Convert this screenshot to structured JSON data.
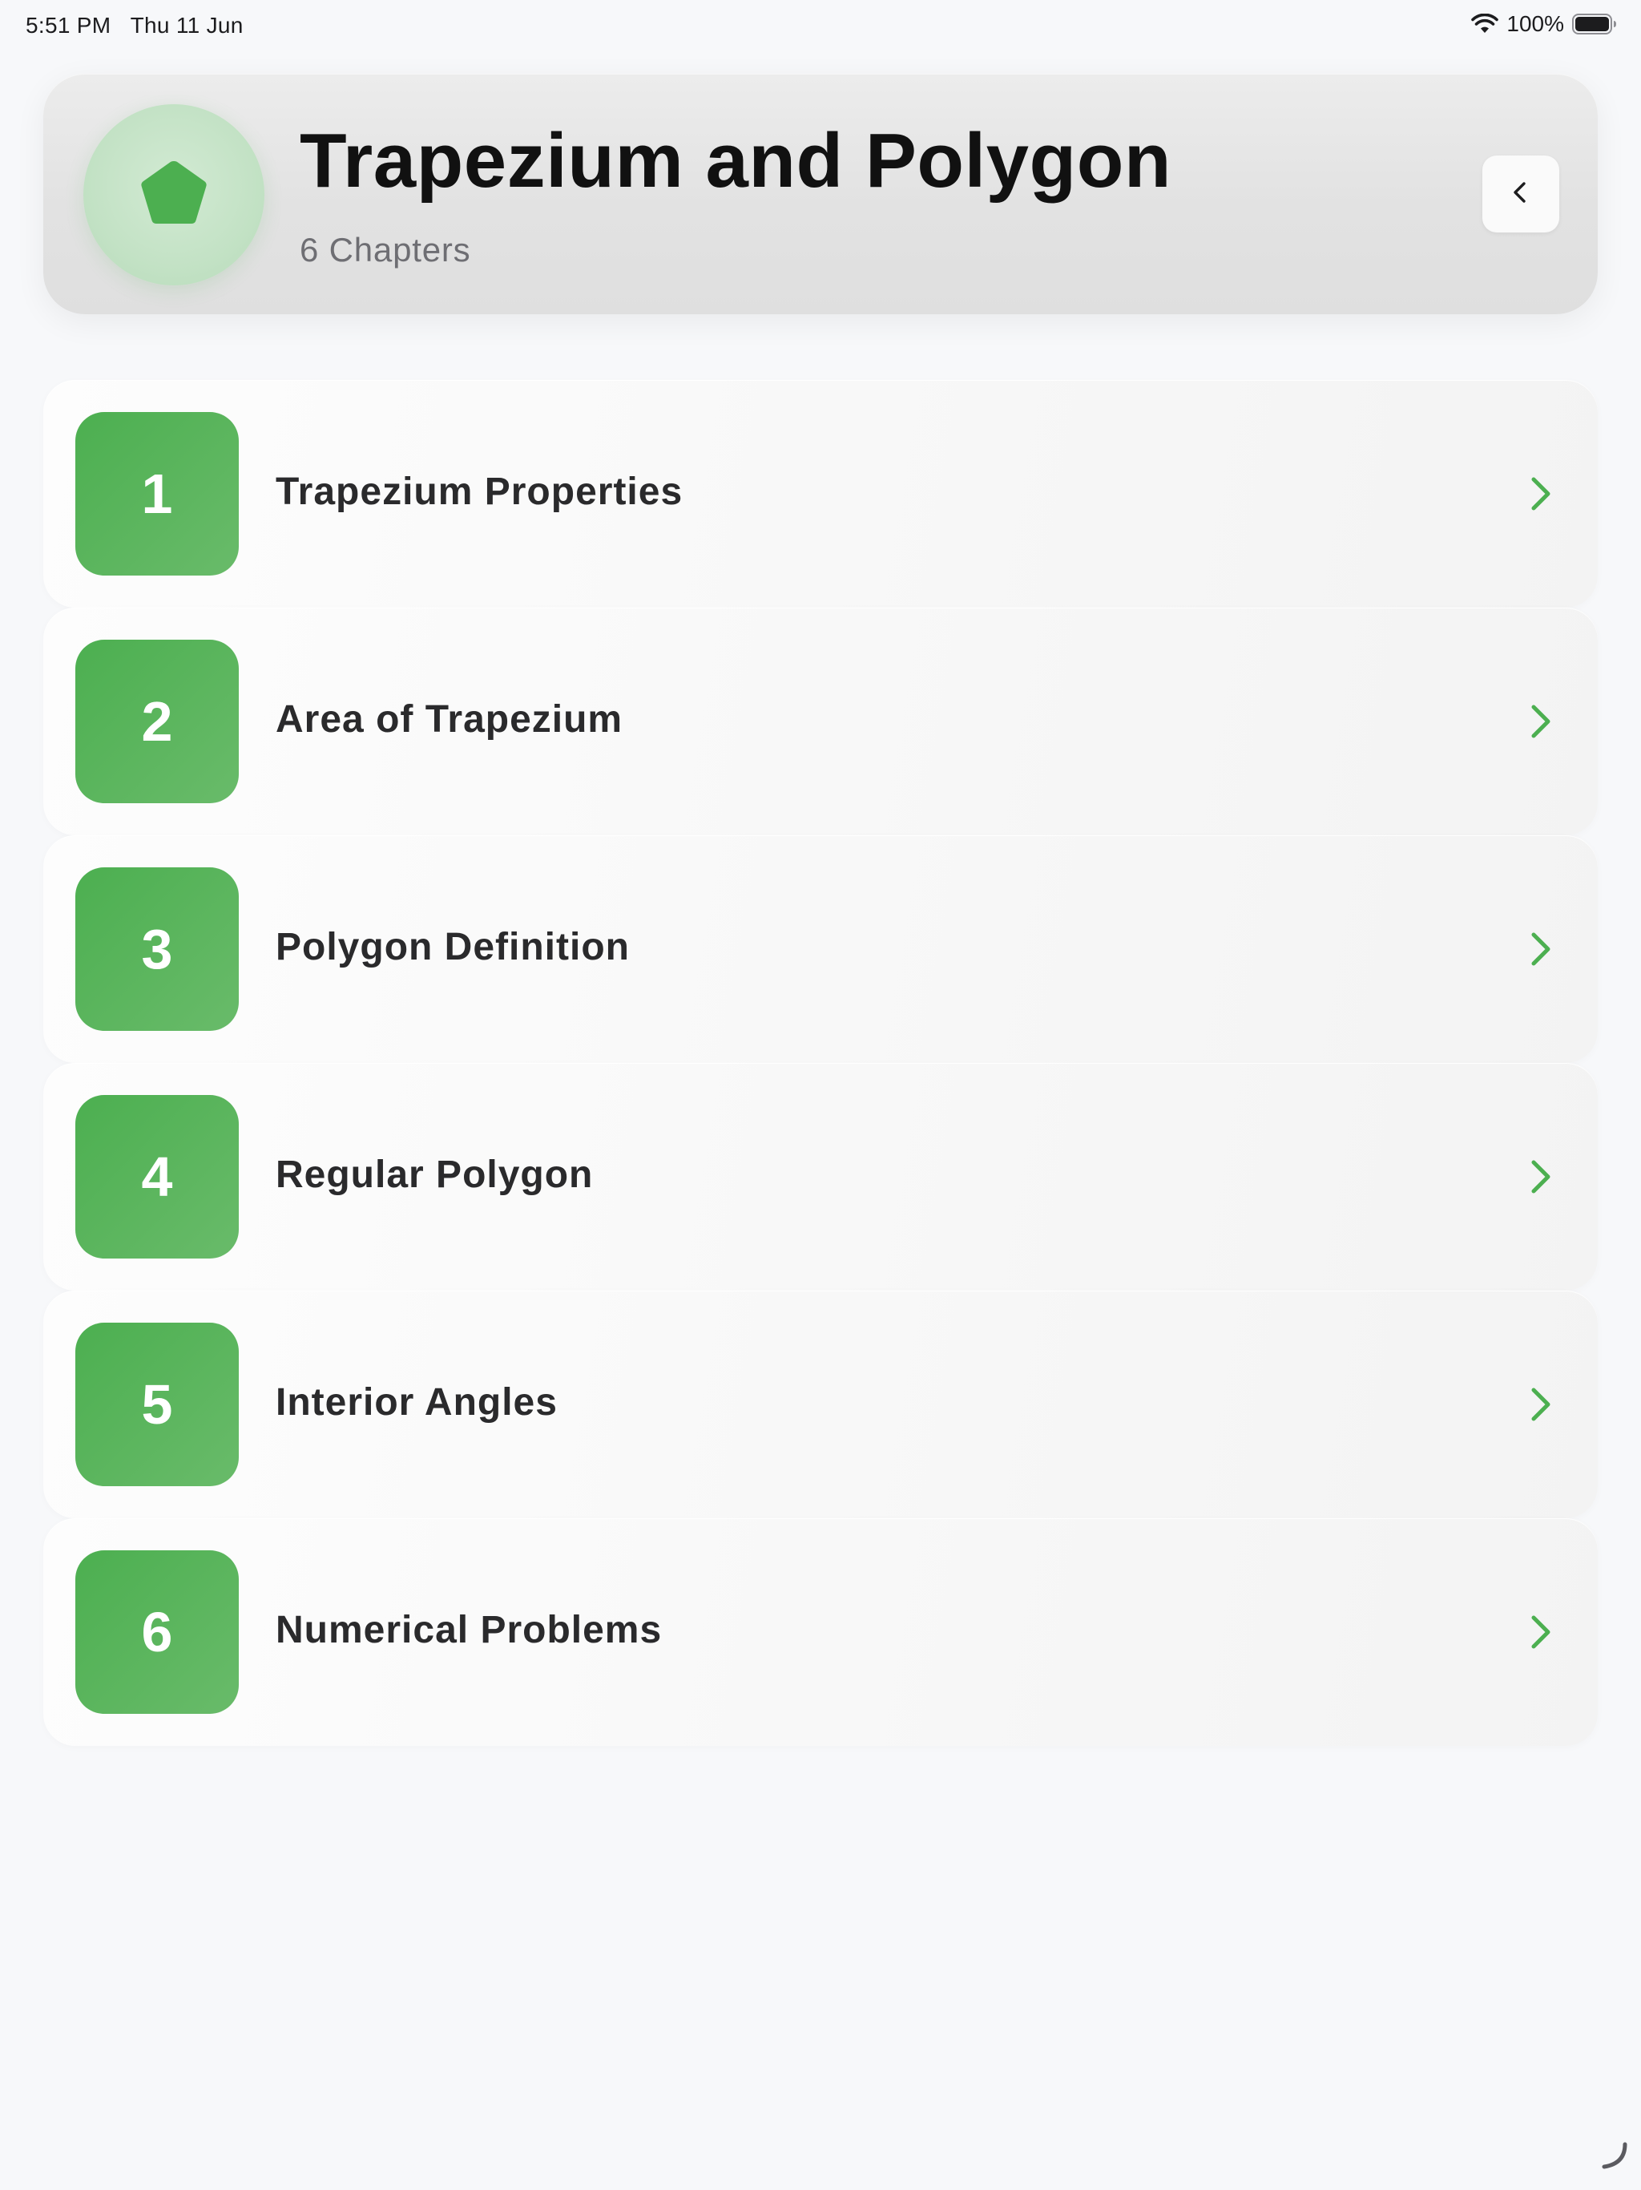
{
  "status_bar": {
    "time": "5:51 PM",
    "date": "Thu 11 Jun",
    "battery": "100%",
    "wifi_icon": "wifi-icon",
    "battery_icon": "battery-icon"
  },
  "header": {
    "title": "Trapezium and Polygon",
    "subtitle": "6 Chapters",
    "icon": "pentagon-icon",
    "back_icon": "chevron-left-icon"
  },
  "colors": {
    "accent": "#4caf50",
    "background": "#f7f8fa",
    "title_text": "#111111",
    "subtitle_text": "#6e6e73"
  },
  "chapters": [
    {
      "number": "1",
      "title": "Trapezium Properties"
    },
    {
      "number": "2",
      "title": "Area of Trapezium"
    },
    {
      "number": "3",
      "title": "Polygon Definition"
    },
    {
      "number": "4",
      "title": "Regular Polygon"
    },
    {
      "number": "5",
      "title": "Interior Angles"
    },
    {
      "number": "6",
      "title": "Numerical Problems"
    }
  ]
}
